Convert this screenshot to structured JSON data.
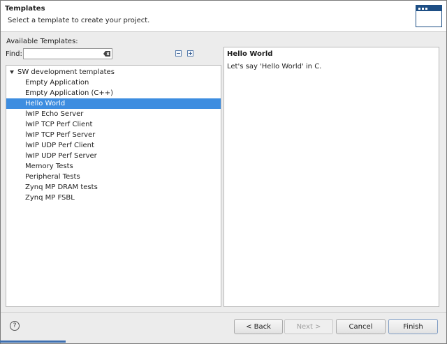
{
  "header": {
    "title": "Templates",
    "subtitle": "Select a template to create your project."
  },
  "available_label": "Available Templates:",
  "find": {
    "label": "Find:",
    "value": "",
    "placeholder": ""
  },
  "tree": {
    "root": "SW development templates",
    "items": [
      "Empty Application",
      "Empty Application (C++)",
      "Hello World",
      "lwIP Echo Server",
      "lwIP TCP Perf Client",
      "lwIP TCP Perf Server",
      "lwIP UDP Perf Client",
      "lwIP UDP Perf Server",
      "Memory Tests",
      "Peripheral Tests",
      "Zynq MP DRAM tests",
      "Zynq MP FSBL"
    ],
    "selected_index": 2
  },
  "description": {
    "title": "Hello World",
    "text": "Let's say 'Hello World' in C."
  },
  "buttons": {
    "back": "< Back",
    "next": "Next >",
    "cancel": "Cancel",
    "finish": "Finish"
  },
  "help_glyph": "?",
  "icons": [
    "wizard-banner-icon",
    "clear-icon",
    "collapse-all-icon",
    "expand-all-icon",
    "tree-expanded-icon",
    "help-icon"
  ],
  "colors": {
    "selection": "#3d8de0",
    "banner_icon": "#1e4f85"
  }
}
